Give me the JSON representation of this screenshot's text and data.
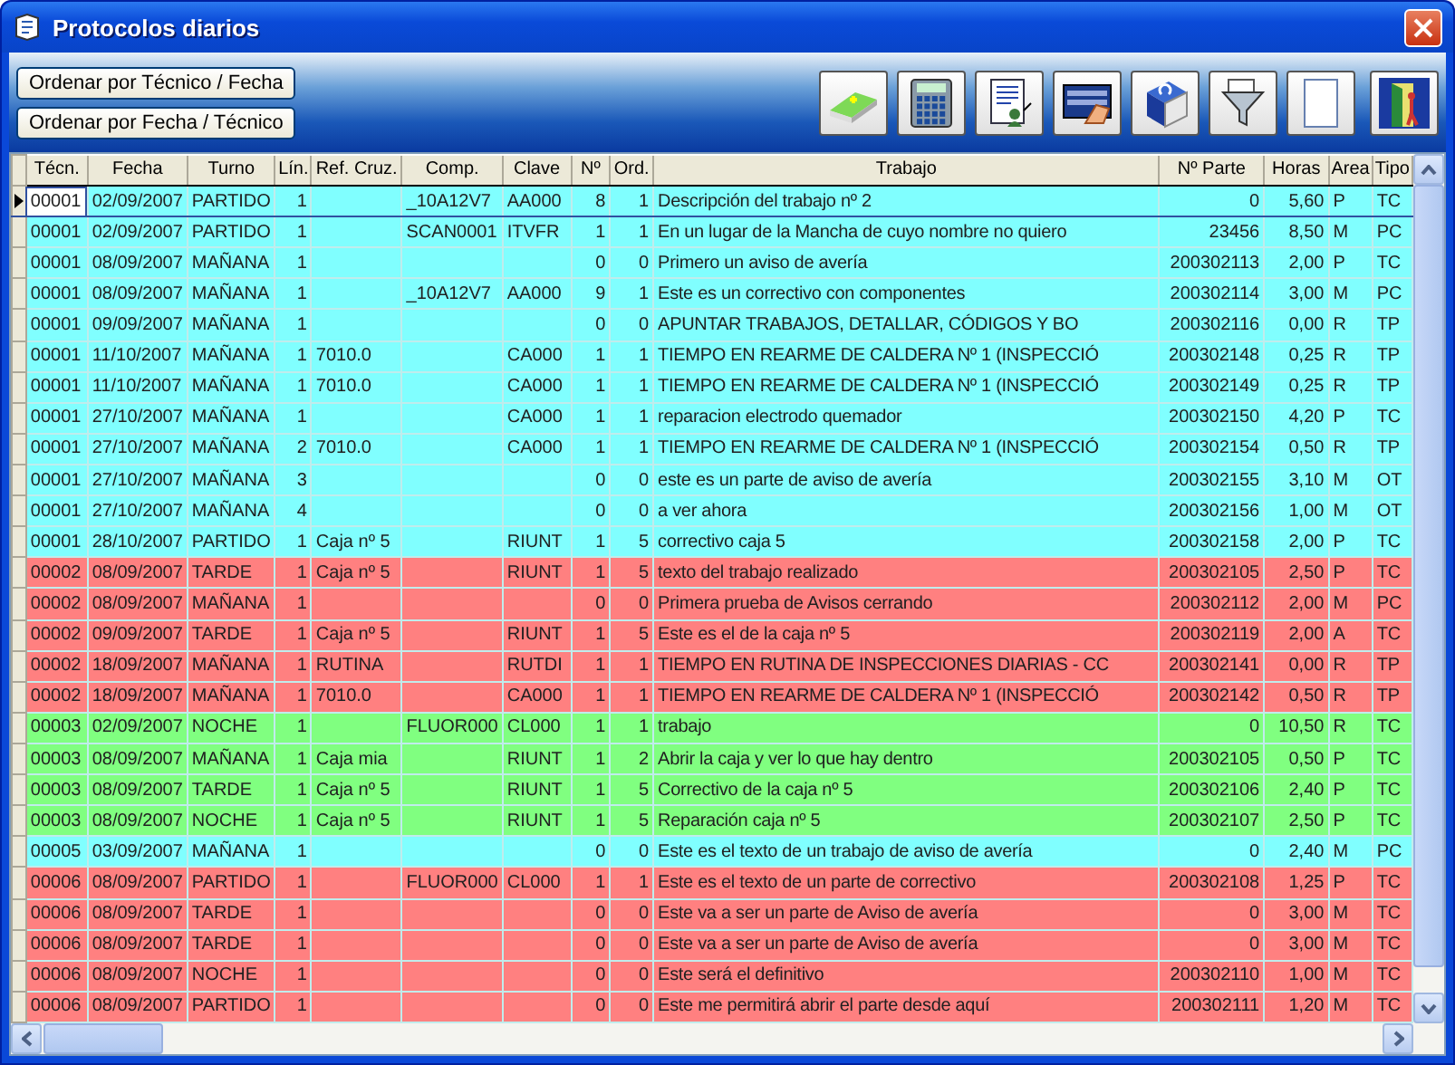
{
  "window": {
    "title": "Protocolos diarios"
  },
  "sort_buttons": [
    "Ordenar por Técnico / Fecha",
    "Ordenar por Fecha / Técnico"
  ],
  "toolbar": [
    {
      "kind": "eraser"
    },
    {
      "kind": "calculator"
    },
    {
      "kind": "document"
    },
    {
      "kind": "card"
    },
    {
      "kind": "book"
    },
    {
      "kind": "funnel"
    },
    {
      "kind": "page"
    },
    {
      "kind": "door"
    }
  ],
  "table": {
    "columns": [
      "Técn.",
      "Fecha",
      "Turno",
      "Lín.",
      "Ref. Cruz.",
      "Comp.",
      "Clave",
      "Nº",
      "Ord.",
      "Trabajo",
      "Nº Parte",
      "Horas",
      "Area",
      "Tipo"
    ],
    "rows": [
      {
        "selected": true,
        "color": "#80ffff",
        "cells": {
          "tecn": "00001",
          "fecha": "02/09/2007",
          "turno": "PARTIDO",
          "lin": "1",
          "comp": "_10A12V7",
          "clave": "AA000",
          "n": "8",
          "ord": "1",
          "trabajo": "Descripción del trabajo nº 2",
          "parte": "0",
          "horas": "5,60",
          "area": "P",
          "tipo": "TC"
        }
      },
      {
        "selected": false,
        "color": "#80ffff",
        "cells": {
          "tecn": "00001",
          "fecha": "02/09/2007",
          "turno": "PARTIDO",
          "lin": "1",
          "comp": "SCAN0001",
          "clave": "ITVFR",
          "n": "1",
          "ord": "1",
          "trabajo": "En un lugar de la Mancha de cuyo nombre no quiero",
          "parte": "23456",
          "horas": "8,50",
          "area": "M",
          "tipo": "PC"
        }
      },
      {
        "selected": false,
        "color": "#80ffff",
        "cells": {
          "tecn": "00001",
          "fecha": "08/09/2007",
          "turno": "MAÑANA",
          "lin": "1",
          "n": "0",
          "ord": "0",
          "trabajo": "Primero un aviso de avería",
          "parte": "200302113",
          "horas": "2,00",
          "area": "P",
          "tipo": "TC"
        }
      },
      {
        "selected": false,
        "color": "#80ffff",
        "cells": {
          "tecn": "00001",
          "fecha": "08/09/2007",
          "turno": "MAÑANA",
          "lin": "1",
          "comp": "_10A12V7",
          "clave": "AA000",
          "n": "9",
          "ord": "1",
          "trabajo": "Este es un correctivo con componentes",
          "parte": "200302114",
          "horas": "3,00",
          "area": "M",
          "tipo": "PC"
        }
      },
      {
        "selected": false,
        "color": "#80ffff",
        "cells": {
          "tecn": "00001",
          "fecha": "09/09/2007",
          "turno": "MAÑANA",
          "lin": "1",
          "n": "0",
          "ord": "0",
          "trabajo": "APUNTAR TRABAJOS, DETALLAR, CÓDIGOS Y BO",
          "parte": "200302116",
          "horas": "0,00",
          "area": "R",
          "tipo": "TP"
        }
      },
      {
        "selected": false,
        "color": "#80ffff",
        "cells": {
          "tecn": "00001",
          "fecha": "11/10/2007",
          "turno": "MAÑANA",
          "lin": "1",
          "ref": "7010.0",
          "clave": "CA000",
          "n": "1",
          "ord": "1",
          "trabajo": "TIEMPO EN REARME DE CALDERA Nº 1 (INSPECCIÓ",
          "parte": "200302148",
          "horas": "0,25",
          "area": "R",
          "tipo": "TP"
        }
      },
      {
        "selected": false,
        "color": "#80ffff",
        "cells": {
          "tecn": "00001",
          "fecha": "11/10/2007",
          "turno": "MAÑANA",
          "lin": "1",
          "ref": "7010.0",
          "clave": "CA000",
          "n": "1",
          "ord": "1",
          "trabajo": "TIEMPO EN REARME DE CALDERA Nº 1 (INSPECCIÓ",
          "parte": "200302149",
          "horas": "0,25",
          "area": "R",
          "tipo": "TP"
        }
      },
      {
        "selected": false,
        "color": "#80ffff",
        "cells": {
          "tecn": "00001",
          "fecha": "27/10/2007",
          "turno": "MAÑANA",
          "lin": "1",
          "clave": "CA000",
          "n": "1",
          "ord": "1",
          "trabajo": "reparacion electrodo quemador",
          "parte": "200302150",
          "horas": "4,20",
          "area": "P",
          "tipo": "TC"
        }
      },
      {
        "selected": false,
        "color": "#80ffff",
        "cells": {
          "tecn": "00001",
          "fecha": "27/10/2007",
          "turno": "MAÑANA",
          "lin": "2",
          "ref": "7010.0",
          "clave": "CA000",
          "n": "1",
          "ord": "1",
          "trabajo": "TIEMPO EN REARME DE CALDERA Nº 1 (INSPECCIÓ",
          "parte": "200302154",
          "horas": "0,50",
          "area": "R",
          "tipo": "TP"
        }
      },
      {
        "selected": false,
        "color": "#80ffff",
        "cells": {
          "tecn": "00001",
          "fecha": "27/10/2007",
          "turno": "MAÑANA",
          "lin": "3",
          "n": "0",
          "ord": "0",
          "trabajo": "este es un parte de aviso de avería",
          "parte": "200302155",
          "horas": "3,10",
          "area": "M",
          "tipo": "OT"
        }
      },
      {
        "selected": false,
        "color": "#80ffff",
        "cells": {
          "tecn": "00001",
          "fecha": "27/10/2007",
          "turno": "MAÑANA",
          "lin": "4",
          "n": "0",
          "ord": "0",
          "trabajo": "a ver ahora",
          "parte": "200302156",
          "horas": "1,00",
          "area": "M",
          "tipo": "OT"
        }
      },
      {
        "selected": false,
        "color": "#80ffff",
        "cells": {
          "tecn": "00001",
          "fecha": "28/10/2007",
          "turno": "PARTIDO",
          "lin": "1",
          "ref": "Caja nº 5",
          "clave": "RIUNT",
          "n": "1",
          "ord": "5",
          "trabajo": "correctivo caja 5",
          "parte": "200302158",
          "horas": "2,00",
          "area": "P",
          "tipo": "TC"
        }
      },
      {
        "selected": false,
        "color": "#ff8080",
        "cells": {
          "tecn": "00002",
          "fecha": "08/09/2007",
          "turno": "TARDE",
          "lin": "1",
          "ref": "Caja nº 5",
          "clave": "RIUNT",
          "n": "1",
          "ord": "5",
          "trabajo": "texto del trabajo realizado",
          "parte": "200302105",
          "horas": "2,50",
          "area": "P",
          "tipo": "TC"
        }
      },
      {
        "selected": false,
        "color": "#ff8080",
        "cells": {
          "tecn": "00002",
          "fecha": "08/09/2007",
          "turno": "MAÑANA",
          "lin": "1",
          "n": "0",
          "ord": "0",
          "trabajo": "Primera prueba de Avisos cerrando",
          "parte": "200302112",
          "horas": "2,00",
          "area": "M",
          "tipo": "PC"
        }
      },
      {
        "selected": false,
        "color": "#ff8080",
        "cells": {
          "tecn": "00002",
          "fecha": "09/09/2007",
          "turno": "TARDE",
          "lin": "1",
          "ref": "Caja nº 5",
          "clave": "RIUNT",
          "n": "1",
          "ord": "5",
          "trabajo": "Este es el de la caja nº 5",
          "parte": "200302119",
          "horas": "2,00",
          "area": "A",
          "tipo": "TC"
        }
      },
      {
        "selected": false,
        "color": "#ff8080",
        "cells": {
          "tecn": "00002",
          "fecha": "18/09/2007",
          "turno": "MAÑANA",
          "lin": "1",
          "ref": "RUTINA",
          "clave": "RUTDI",
          "n": "1",
          "ord": "1",
          "trabajo": "TIEMPO EN RUTINA DE INSPECCIONES DIARIAS - CC",
          "parte": "200302141",
          "horas": "0,00",
          "area": "R",
          "tipo": "TP"
        }
      },
      {
        "selected": false,
        "color": "#ff8080",
        "cells": {
          "tecn": "00002",
          "fecha": "18/09/2007",
          "turno": "MAÑANA",
          "lin": "1",
          "ref": "7010.0",
          "clave": "CA000",
          "n": "1",
          "ord": "1",
          "trabajo": "TIEMPO EN REARME DE CALDERA Nº 1 (INSPECCIÓ",
          "parte": "200302142",
          "horas": "0,50",
          "area": "R",
          "tipo": "TP"
        }
      },
      {
        "selected": false,
        "color": "#80ff80",
        "cells": {
          "tecn": "00003",
          "fecha": "02/09/2007",
          "turno": "NOCHE",
          "lin": "1",
          "comp": "FLUOR000",
          "clave": "CL000",
          "n": "1",
          "ord": "1",
          "trabajo": "trabajo",
          "parte": "0",
          "horas": "10,50",
          "area": "R",
          "tipo": "TC"
        }
      },
      {
        "selected": false,
        "color": "#80ff80",
        "cells": {
          "tecn": "00003",
          "fecha": "08/09/2007",
          "turno": "MAÑANA",
          "lin": "1",
          "ref": "Caja mia",
          "clave": "RIUNT",
          "n": "1",
          "ord": "2",
          "trabajo": "Abrir la caja y ver lo que hay dentro",
          "parte": "200302105",
          "horas": "0,50",
          "area": "P",
          "tipo": "TC"
        }
      },
      {
        "selected": false,
        "color": "#80ff80",
        "cells": {
          "tecn": "00003",
          "fecha": "08/09/2007",
          "turno": "TARDE",
          "lin": "1",
          "ref": "Caja nº 5",
          "clave": "RIUNT",
          "n": "1",
          "ord": "5",
          "trabajo": "Correctivo de la caja nº 5",
          "parte": "200302106",
          "horas": "2,40",
          "area": "P",
          "tipo": "TC"
        }
      },
      {
        "selected": false,
        "color": "#80ff80",
        "cells": {
          "tecn": "00003",
          "fecha": "08/09/2007",
          "turno": "NOCHE",
          "lin": "1",
          "ref": "Caja nº 5",
          "clave": "RIUNT",
          "n": "1",
          "ord": "5",
          "trabajo": "Reparación caja nº 5",
          "parte": "200302107",
          "horas": "2,50",
          "area": "P",
          "tipo": "TC"
        }
      },
      {
        "selected": false,
        "color": "#80ffff",
        "cells": {
          "tecn": "00005",
          "fecha": "03/09/2007",
          "turno": "MAÑANA",
          "lin": "1",
          "n": "0",
          "ord": "0",
          "trabajo": "Este es el texto de un trabajo de aviso de avería",
          "parte": "0",
          "horas": "2,40",
          "area": "M",
          "tipo": "PC"
        }
      },
      {
        "selected": false,
        "color": "#ff8080",
        "cells": {
          "tecn": "00006",
          "fecha": "08/09/2007",
          "turno": "PARTIDO",
          "lin": "1",
          "comp": "FLUOR000",
          "clave": "CL000",
          "n": "1",
          "ord": "1",
          "trabajo": "Este es el texto de un parte de correctivo",
          "parte": "200302108",
          "horas": "1,25",
          "area": "P",
          "tipo": "TC"
        }
      },
      {
        "selected": false,
        "color": "#ff8080",
        "cells": {
          "tecn": "00006",
          "fecha": "08/09/2007",
          "turno": "TARDE",
          "lin": "1",
          "n": "0",
          "ord": "0",
          "trabajo": "Este va a ser un parte de Aviso de avería",
          "parte": "0",
          "horas": "3,00",
          "area": "M",
          "tipo": "TC"
        }
      },
      {
        "selected": false,
        "color": "#ff8080",
        "cells": {
          "tecn": "00006",
          "fecha": "08/09/2007",
          "turno": "TARDE",
          "lin": "1",
          "n": "0",
          "ord": "0",
          "trabajo": "Este va a ser un parte de Aviso de avería",
          "parte": "0",
          "horas": "3,00",
          "area": "M",
          "tipo": "TC"
        }
      },
      {
        "selected": false,
        "color": "#ff8080",
        "cells": {
          "tecn": "00006",
          "fecha": "08/09/2007",
          "turno": "NOCHE",
          "lin": "1",
          "n": "0",
          "ord": "0",
          "trabajo": "Este será el definitivo",
          "parte": "200302110",
          "horas": "1,00",
          "area": "M",
          "tipo": "TC"
        }
      },
      {
        "selected": false,
        "color": "#ff8080",
        "cells": {
          "tecn": "00006",
          "fecha": "08/09/2007",
          "turno": "PARTIDO",
          "lin": "1",
          "n": "0",
          "ord": "0",
          "trabajo": "Este me permitirá abrir el parte desde aquí",
          "parte": "200302111",
          "horas": "1,20",
          "area": "M",
          "tipo": "TC"
        }
      }
    ]
  }
}
